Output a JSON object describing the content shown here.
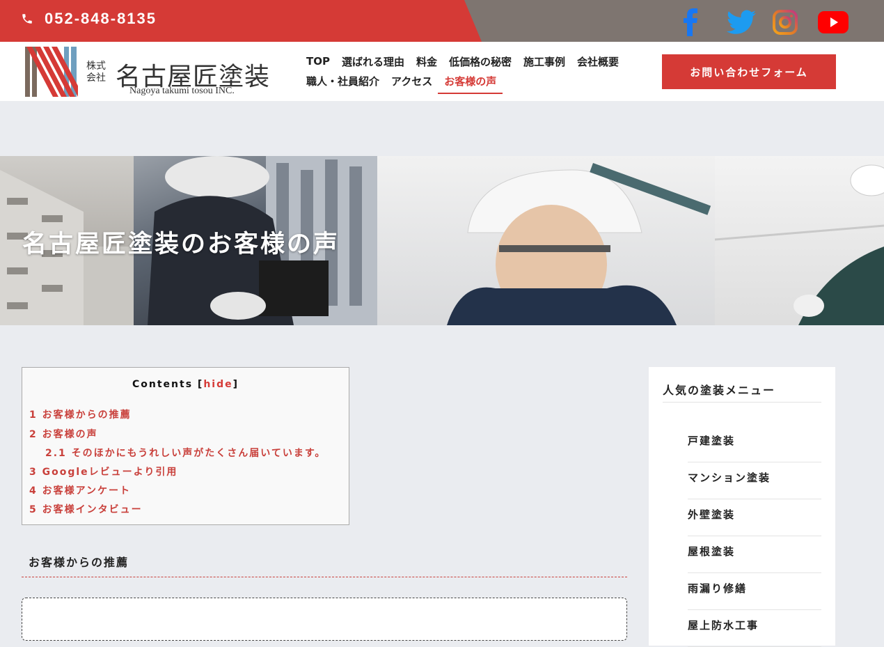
{
  "topbar": {
    "phone": "052-848-8135",
    "social": [
      "facebook-icon",
      "twitter-icon",
      "instagram-icon",
      "youtube-icon"
    ]
  },
  "logo": {
    "small1": "株式",
    "small2": "会社",
    "name": "名古屋匠塗装",
    "en": "Nagoya takumi tosou INC."
  },
  "nav": {
    "row1": [
      "TOP",
      "選ばれる理由",
      "料金",
      "低価格の秘密",
      "施工事例",
      "会社概要"
    ],
    "row2": [
      "職人・社員紹介",
      "アクセス",
      "お客様の声"
    ],
    "active": "お客様の声"
  },
  "contact_button": "お問い合わせフォーム",
  "hero": {
    "title": "名古屋匠塗装のお客様の声"
  },
  "toc": {
    "title": "Contents",
    "bracket_open": "[",
    "hide": "hide",
    "bracket_close": "]",
    "items": [
      "1 お客様からの推薦",
      "2 お客様の声",
      "2.1 そのほかにもうれしい声がたくさん届いています。",
      "3 Googleレビューより引用",
      "4 お客様アンケート",
      "5 お客様インタビュー"
    ]
  },
  "section": {
    "heading": "お客様からの推薦"
  },
  "sidebar": {
    "title": "人気の塗装メニュー",
    "items": [
      "戸建塗装",
      "マンション塗装",
      "外壁塗装",
      "屋根塗装",
      "雨漏り修繕",
      "屋上防水工事"
    ]
  },
  "colors": {
    "accent": "#d53a36",
    "topbar_gray": "#7e7570"
  }
}
